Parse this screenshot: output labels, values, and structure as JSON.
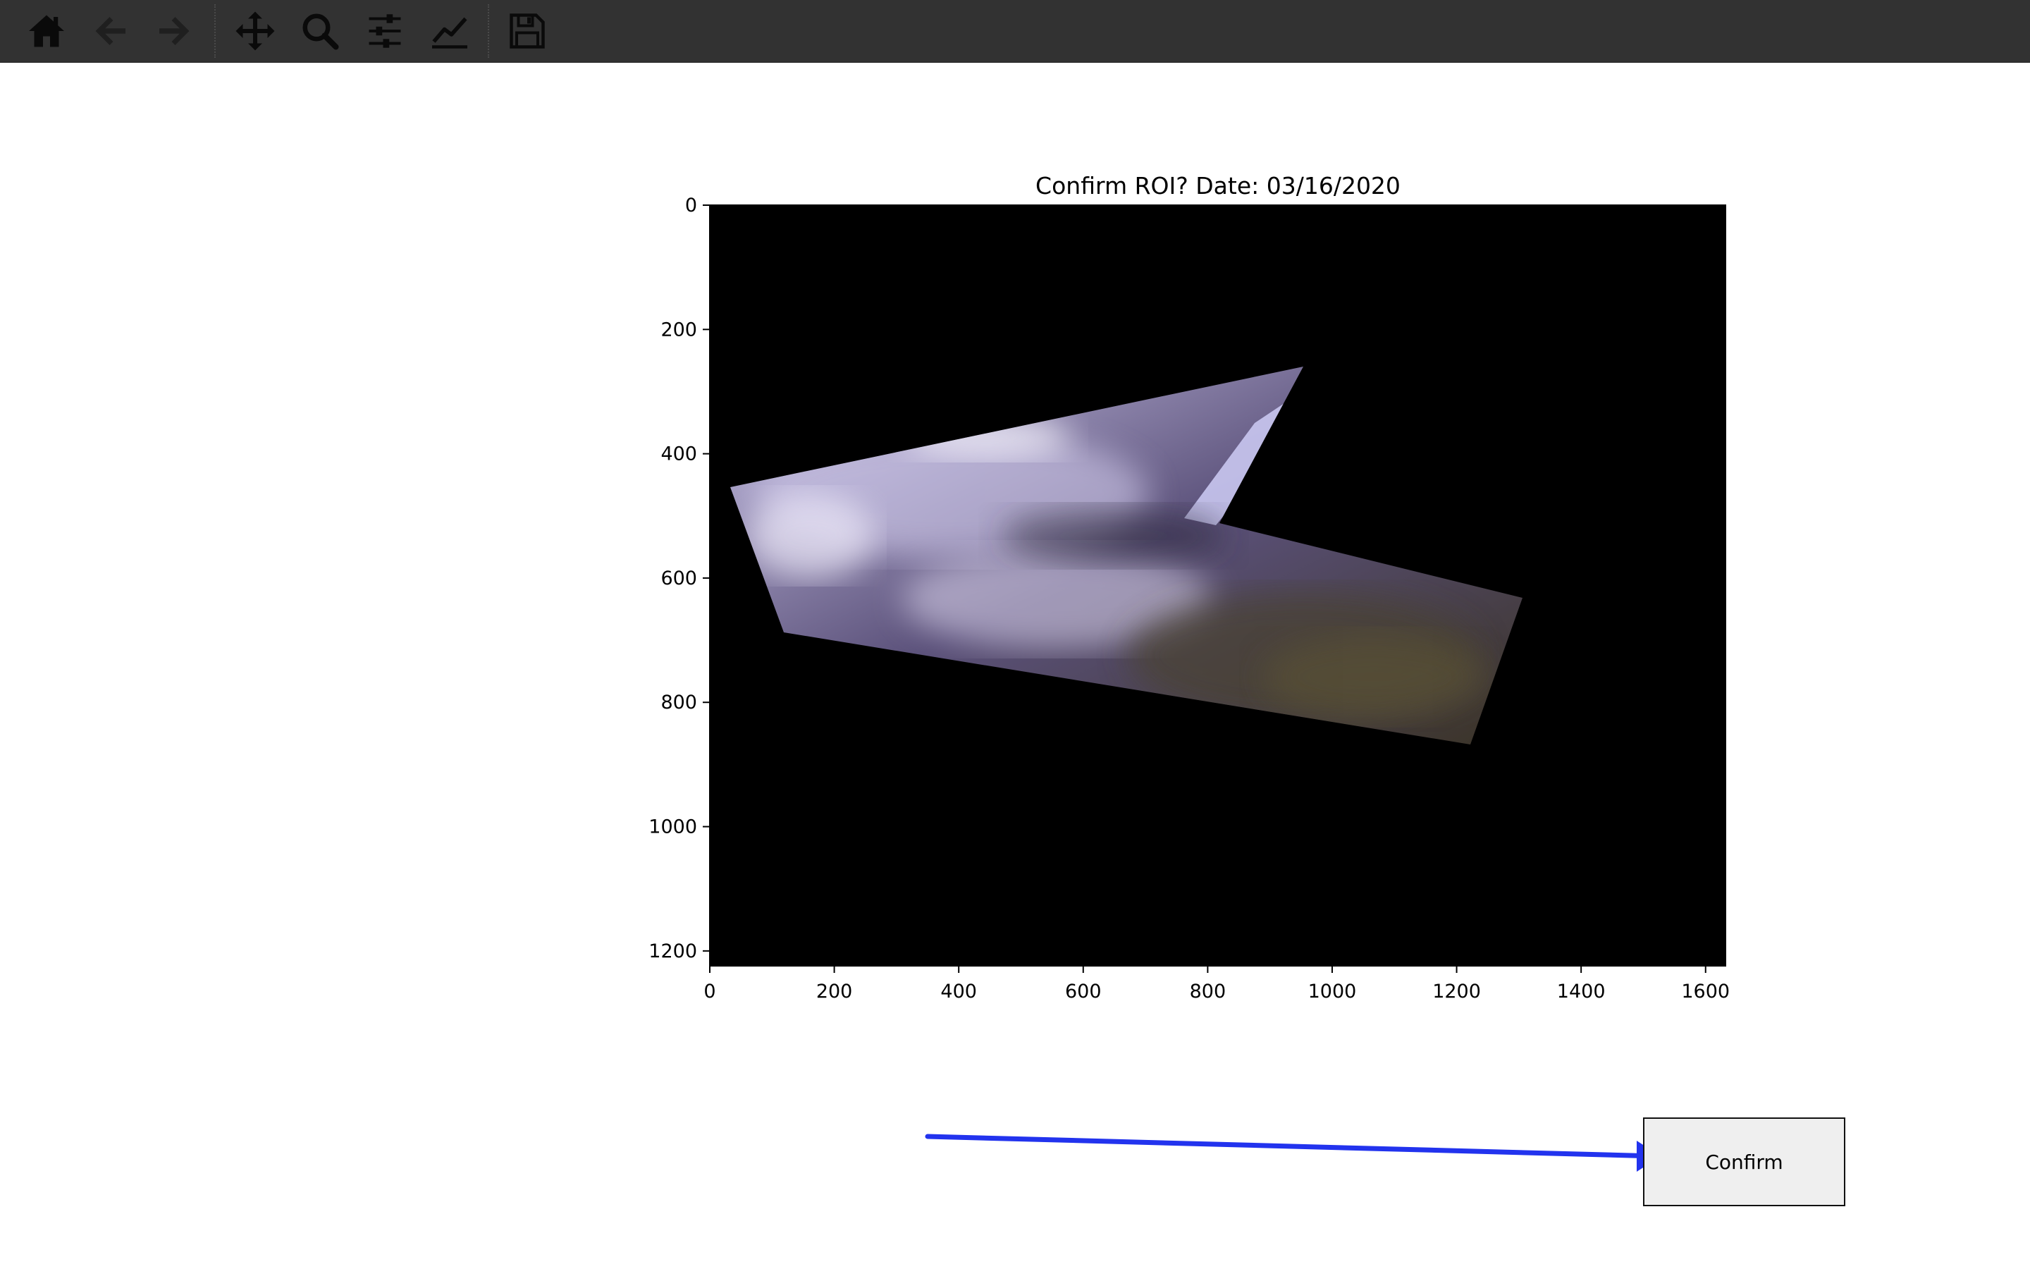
{
  "toolbar": {
    "buttons": [
      {
        "name": "home-icon",
        "label": "Home"
      },
      {
        "name": "back-icon",
        "label": "Back"
      },
      {
        "name": "forward-icon",
        "label": "Forward"
      },
      {
        "name": "pan-icon",
        "label": "Pan"
      },
      {
        "name": "zoom-icon",
        "label": "Zoom"
      },
      {
        "name": "subplots-icon",
        "label": "Configure subplots"
      },
      {
        "name": "edit-curve-icon",
        "label": "Edit axis, curve and image parameters"
      },
      {
        "name": "save-icon",
        "label": "Save"
      }
    ],
    "colors": {
      "background": "#323232",
      "icon": "#0a0a0a",
      "icon_disabled": "#1f1f1f"
    }
  },
  "plot": {
    "title": "Confirm ROI? Date: 03/16/2020",
    "xticks": [
      "0",
      "200",
      "400",
      "600",
      "800",
      "1000",
      "1200",
      "1400",
      "1600"
    ],
    "yticks": [
      "0",
      "200",
      "400",
      "600",
      "800",
      "1000",
      "1200"
    ],
    "x_range": [
      0,
      1632
    ],
    "y_range": [
      1224,
      0
    ]
  },
  "confirm_button": {
    "label": "Confirm"
  },
  "annotation": {
    "type": "arrow",
    "color": "#2233ee",
    "points_to": "confirm-button"
  }
}
